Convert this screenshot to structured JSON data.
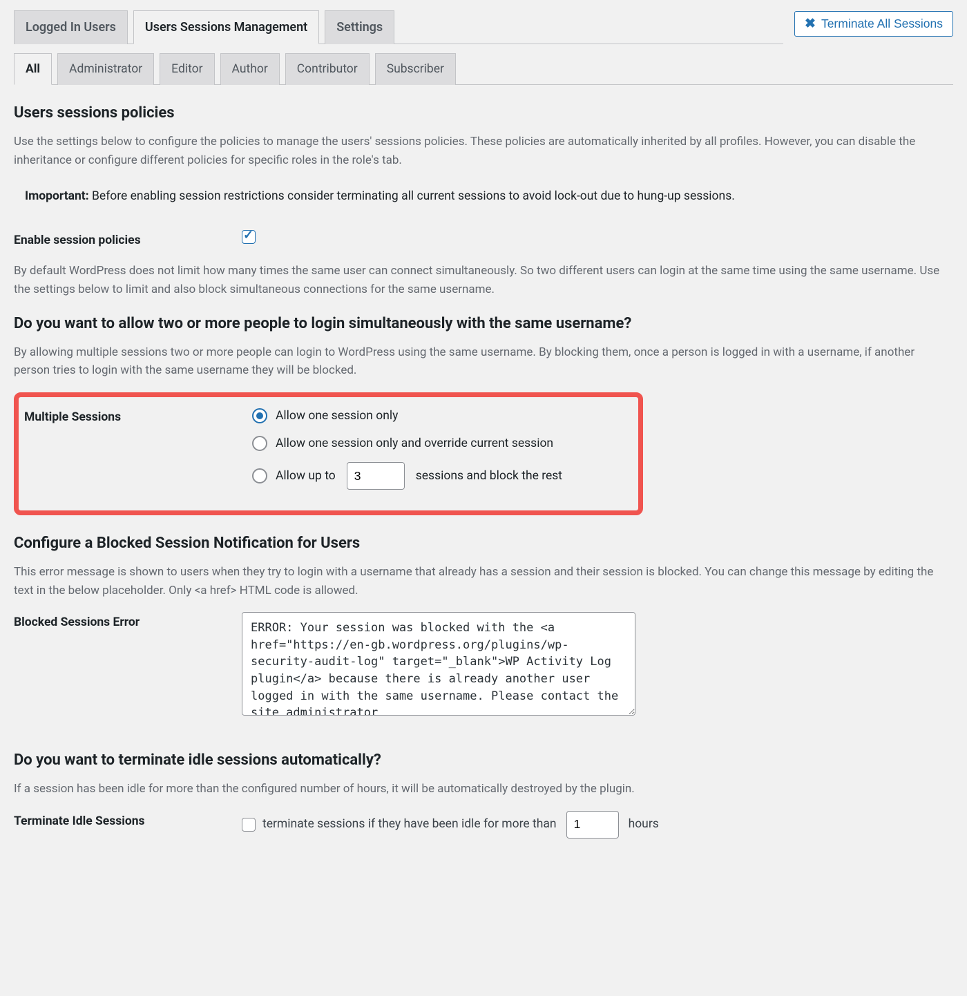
{
  "primaryTabs": {
    "loggedIn": "Logged In Users",
    "sessions": "Users Sessions Management",
    "settings": "Settings"
  },
  "terminateBtn": "Terminate All Sessions",
  "subTabs": {
    "all": "All",
    "administrator": "Administrator",
    "editor": "Editor",
    "author": "Author",
    "contributor": "Contributor",
    "subscriber": "Subscriber"
  },
  "sections": {
    "policiesHeading": "Users sessions policies",
    "policiesDesc": "Use the settings below to configure the policies to manage the users' sessions policies. These policies are automatically inherited by all profiles. However, you can disable the inheritance or configure different policies for specific roles in the role's tab.",
    "importantLabel": "Imoportant:",
    "importantText": " Before enabling session restrictions consider terminating all current sessions to avoid lock-out due to hung-up sessions.",
    "enableLabel": "Enable session policies",
    "defaultNote": "By default WordPress does not limit how many times the same user can connect simultaneously. So two different users can login at the same time using the same username. Use the settings below to limit and also block simultaneous connections for the same username.",
    "multiHeading": "Do you want to allow two or more people to login simultaneously with the same username?",
    "multiDesc": "By allowing multiple sessions two or more people can login to WordPress using the same username. By blocking them, once a person is logged in with a username, if another person tries to login with the same username they will be blocked.",
    "multiLabel": "Multiple Sessions",
    "radio1": "Allow one session only",
    "radio2": "Allow one session only and override current session",
    "radio3a": "Allow up to",
    "radio3value": "3",
    "radio3b": "sessions and block the rest",
    "blockedHeading": "Configure a Blocked Session Notification for Users",
    "blockedDesc": "This error message is shown to users when they try to login with a username that already has a session and their session is blocked. You can change this message by editing the text in the below placeholder. Only <a href> HTML code is allowed.",
    "blockedErrLabel": "Blocked Sessions Error",
    "blockedErrValue": "ERROR: Your session was blocked with the <a href=\"https://en-gb.wordpress.org/plugins/wp-security-audit-log\" target=\"_blank\">WP Activity Log plugin</a> because there is already another user logged in with the same username. Please contact the site administrator",
    "idleHeading": "Do you want to terminate idle sessions automatically?",
    "idleDesc": "If a session has been idle for more than the configured number of hours, it will be automatically destroyed by the plugin.",
    "idleLabel": "Terminate Idle Sessions",
    "idleText1": "terminate sessions if they have been idle for more than",
    "idleValue": "1",
    "idleText2": "hours"
  }
}
